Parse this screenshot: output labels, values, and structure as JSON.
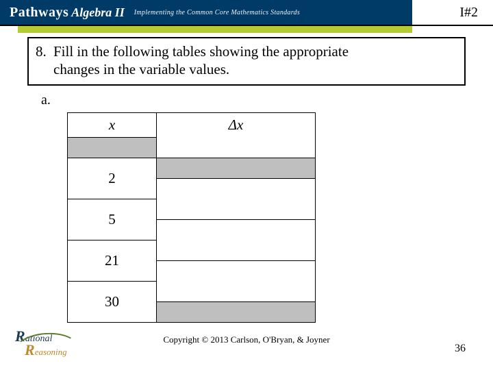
{
  "page_code": "I#2",
  "header": {
    "brand1": "Pathways",
    "brand2": "Algebra II",
    "tagline": "Implementing the Common Core Mathematics Standards"
  },
  "question": {
    "number": "8.",
    "text_line1": "Fill in the following tables showing the appropriate",
    "text_line2": "changes in the variable values.",
    "sub_label": "a."
  },
  "table": {
    "head_x": "x",
    "head_dx": "Δx",
    "x_values": [
      "2",
      "5",
      "21",
      "30"
    ]
  },
  "logo": {
    "word1": "ational",
    "cap1": "R",
    "word2": "easoning",
    "cap2": "R"
  },
  "copyright": "Copyright © 2013 Carlson, O'Bryan, & Joyner",
  "page_number": "36"
}
